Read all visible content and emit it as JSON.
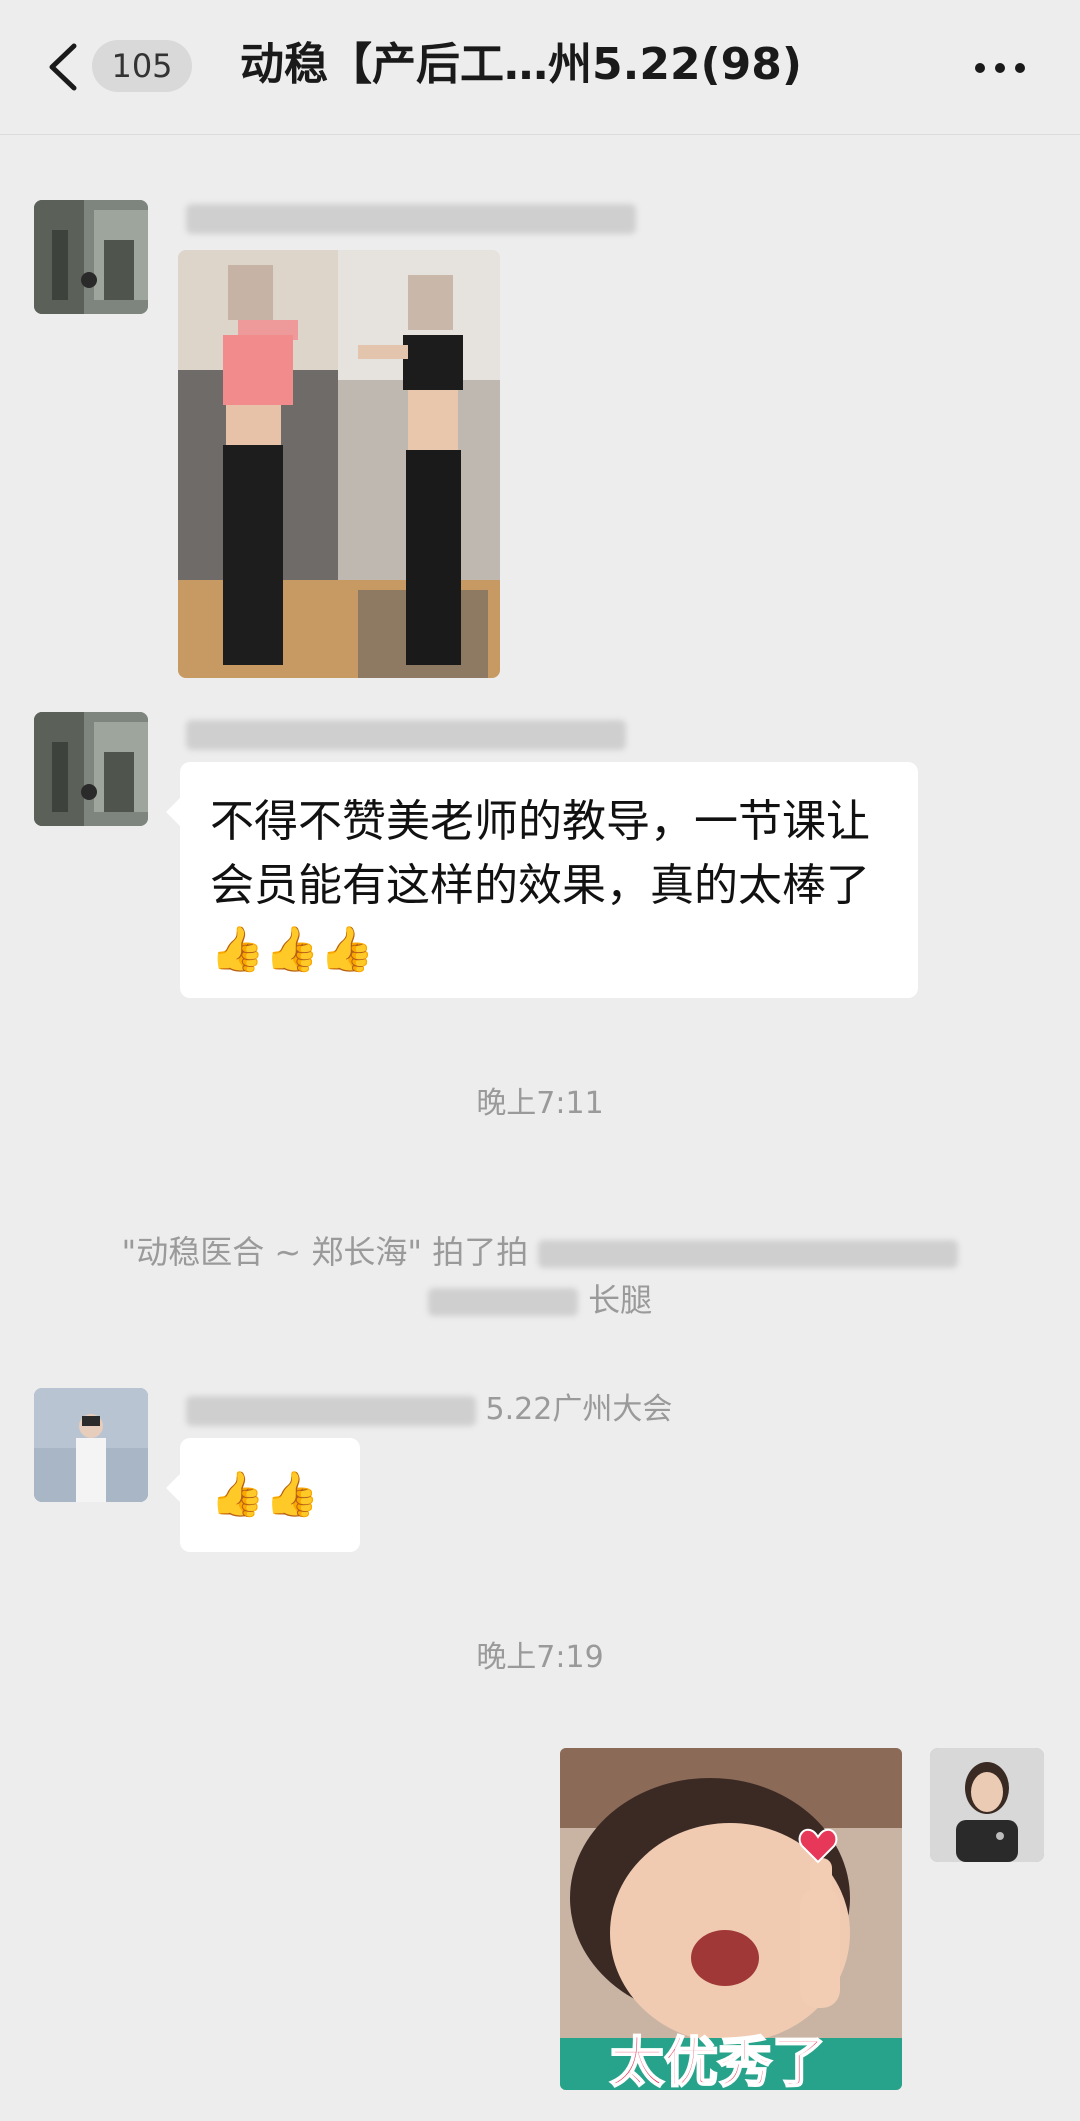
{
  "header": {
    "back_label": "<",
    "unread_count": "105",
    "title": "动稳【产后工…州5.22(98)",
    "more_label": "···"
  },
  "messages": [
    {
      "kind": "image",
      "sender_name_visible": ""
    },
    {
      "kind": "text",
      "text": "不得不赞美老师的教导，一节课让会员能有这样的效果，真的太棒了👍👍👍"
    },
    {
      "kind": "timestamp",
      "text": "晚上7:11"
    },
    {
      "kind": "system",
      "line1_prefix": "\"动稳医合 ~ 郑长海\" 拍了拍",
      "line2_suffix": "长腿"
    },
    {
      "kind": "text",
      "sender_name_suffix": "5.22广州大会",
      "text": "👍👍"
    },
    {
      "kind": "timestamp",
      "text": "晚上7:19"
    },
    {
      "kind": "sticker",
      "caption": "太优秀了"
    }
  ],
  "colors": {
    "background": "#ededed",
    "bubble_received": "#ffffff",
    "muted_text": "#9a9a9a",
    "sticker_caption": "#e8385a"
  },
  "icons": [
    "back-icon",
    "more-icon",
    "thumbs-up-icon",
    "heart-icon"
  ]
}
